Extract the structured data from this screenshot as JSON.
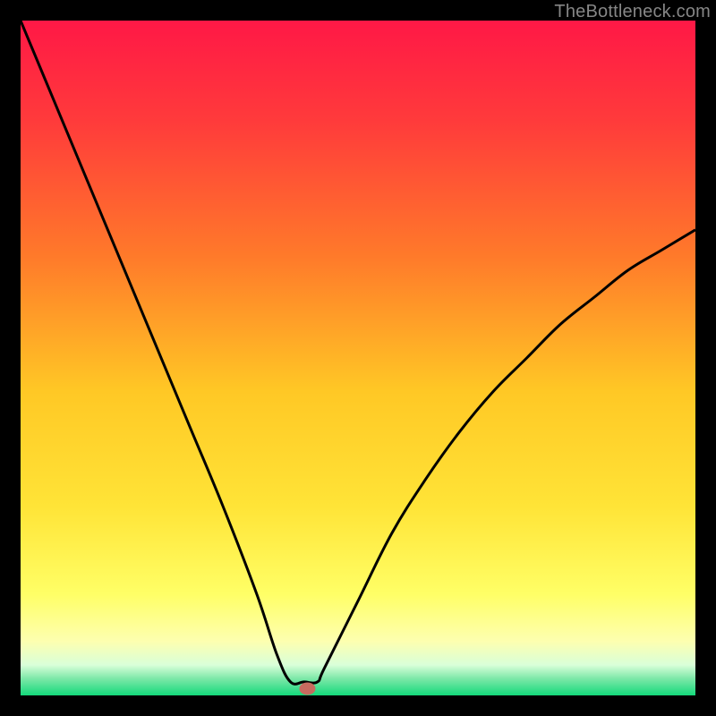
{
  "watermark": "TheBottleneck.com",
  "chart_data": {
    "type": "line",
    "title": "",
    "xlabel": "",
    "ylabel": "",
    "xlim": [
      0,
      100
    ],
    "ylim": [
      0,
      100
    ],
    "grid": false,
    "x": [
      0,
      5,
      10,
      15,
      20,
      25,
      30,
      35,
      38,
      40,
      42,
      44,
      45,
      50,
      55,
      60,
      65,
      70,
      75,
      80,
      85,
      90,
      95,
      100
    ],
    "y": [
      100,
      88,
      76,
      64,
      52,
      40,
      28,
      15,
      6,
      2,
      2,
      2,
      4,
      14,
      24,
      32,
      39,
      45,
      50,
      55,
      59,
      63,
      66,
      69
    ],
    "marker": {
      "x": 42.5,
      "y": 1.0
    },
    "gradient_stops": [
      {
        "offset": 0.0,
        "color": "#ff1846"
      },
      {
        "offset": 0.15,
        "color": "#ff3b3b"
      },
      {
        "offset": 0.35,
        "color": "#ff7a2a"
      },
      {
        "offset": 0.55,
        "color": "#ffc825"
      },
      {
        "offset": 0.72,
        "color": "#ffe437"
      },
      {
        "offset": 0.85,
        "color": "#ffff66"
      },
      {
        "offset": 0.92,
        "color": "#fdffb0"
      },
      {
        "offset": 0.955,
        "color": "#d9ffd9"
      },
      {
        "offset": 0.975,
        "color": "#7de8a8"
      },
      {
        "offset": 1.0,
        "color": "#14d97b"
      }
    ]
  }
}
